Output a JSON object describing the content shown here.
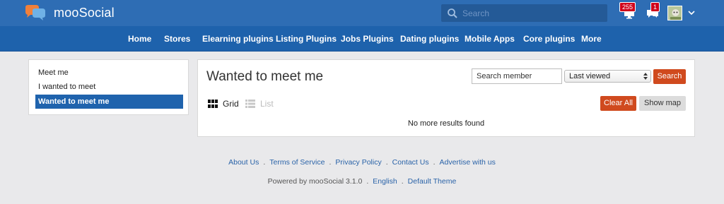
{
  "header": {
    "brand": "mooSocial",
    "search_placeholder": "Search",
    "notifications_count": "255",
    "messages_count": "1"
  },
  "nav": {
    "items": [
      "Home",
      "Stores",
      "Elearning plugins",
      "Listing Plugins",
      "Jobs Plugins",
      "Dating plugins",
      "Mobile Apps",
      "Core plugins",
      "More"
    ]
  },
  "sidebar": {
    "items": [
      {
        "label": "Meet me"
      },
      {
        "label": "I wanted to meet"
      },
      {
        "label": "Wanted to meet me"
      }
    ]
  },
  "main": {
    "title": "Wanted to meet me",
    "member_search_placeholder": "Search member",
    "sort_selected": "Last viewed",
    "search_button": "Search",
    "view_grid": "Grid",
    "view_list": "List",
    "clear_all": "Clear All",
    "show_map": "Show map",
    "empty_message": "No more results found"
  },
  "footer": {
    "links": [
      "About Us",
      "Terms of Service",
      "Privacy Policy",
      "Contact Us",
      "Advertise with us"
    ],
    "separator": ".",
    "powered_by": "Powered by mooSocial 3.1.0",
    "language": "English",
    "theme": "Default Theme"
  },
  "colors": {
    "topbar": "#2e6db4",
    "navbar": "#1e62ac",
    "accent_button": "#d04a1e",
    "badge": "#d0021b",
    "link": "#2a63a8"
  }
}
